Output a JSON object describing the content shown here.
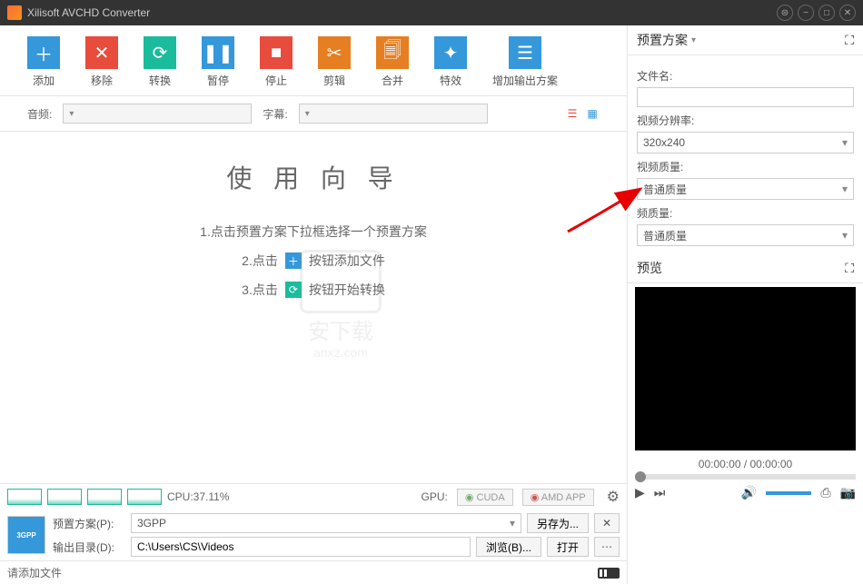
{
  "title": "Xilisoft AVCHD Converter",
  "toolbar": {
    "add": "添加",
    "remove": "移除",
    "convert": "转换",
    "pause": "暂停",
    "stop": "停止",
    "cut": "剪辑",
    "merge": "合并",
    "effect": "特效",
    "addprofile": "增加输出方案"
  },
  "subrow": {
    "audio": "音频:",
    "subtitle": "字幕:"
  },
  "wizard": {
    "title": "使 用 向 导",
    "step1": "1.点击预置方案下拉框选择一个预置方案",
    "step2_pre": "2.点击",
    "step2_post": "按钮添加文件",
    "step3_pre": "3.点击",
    "step3_post": "按钮开始转换"
  },
  "watermark": {
    "text": "安下载",
    "url": "anxz.com"
  },
  "cpu": {
    "label": "CPU:37.11%",
    "gpu_label": "GPU:",
    "cuda": "CUDA",
    "amd": "AMD APP"
  },
  "profile": {
    "preset_label": "预置方案(P):",
    "preset_value": "3GPP",
    "saveas": "另存为...",
    "output_label": "输出目录(D):",
    "output_value": "C:\\Users\\CS\\Videos",
    "browse": "浏览(B)...",
    "open": "打开"
  },
  "status": "请添加文件",
  "right": {
    "preset_header": "预置方案",
    "filename": "文件名:",
    "resolution": "视频分辨率:",
    "resolution_value": "320x240",
    "vquality": "视频质量:",
    "vquality_value": "普通质量",
    "aquality": "频质量:",
    "aquality_value": "普通质量",
    "preview_header": "预览",
    "time": "00:00:00 / 00:00:00"
  }
}
